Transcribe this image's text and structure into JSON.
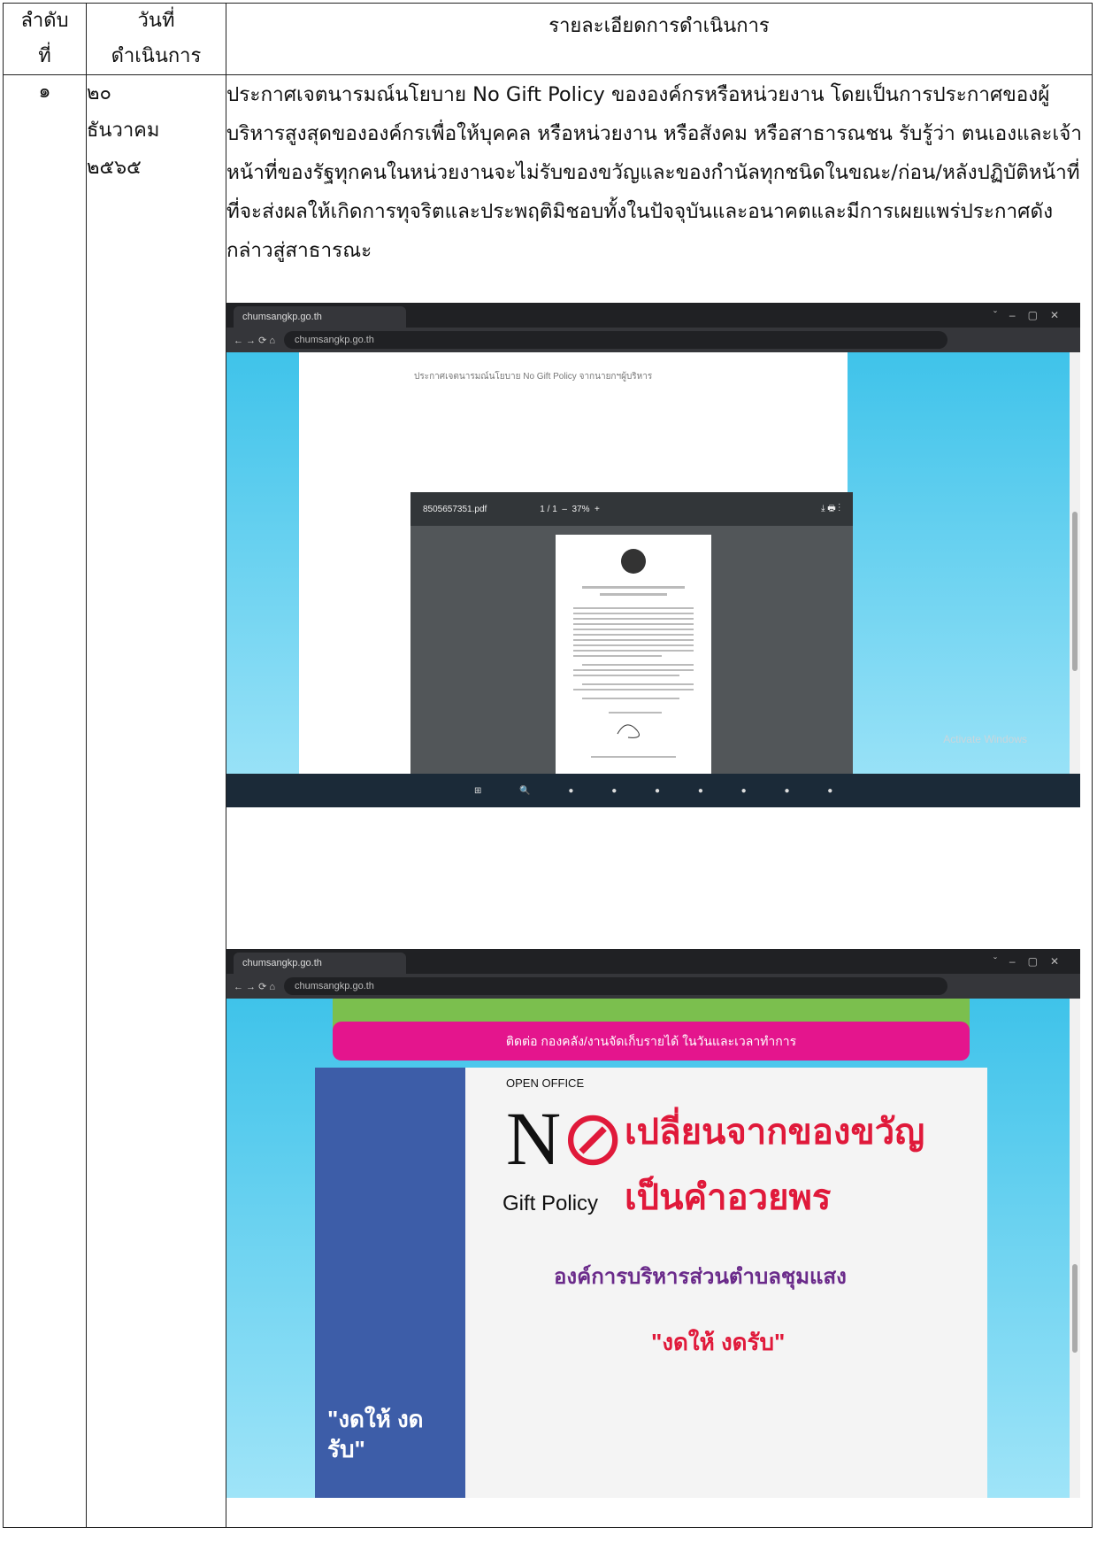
{
  "table": {
    "headers": [
      "ลำดับ\nที่",
      "วันที่\nดำเนินการ",
      "รายละเอียดการดำเนินการ"
    ],
    "row": {
      "no": "๑",
      "date_lines": [
        "๒๐",
        "ธันวาคม",
        "๒๕๖๕"
      ],
      "description": "ประกาศเจตนารมณ์นโยบาย No Gift Policy  ขององค์กรหรือหน่วยงาน โดยเป็นการประกาศของผู้บริหารสูงสุดขององค์กรเพื่อให้บุคคล หรือหน่วยงาน หรือสังคม หรือสาธารณชน รับรู้ว่า ตนเองและเจ้าหน้าที่ของรัฐทุกคนในหน่วยงานจะไม่รับของขวัญและของกำนัลทุกชนิดในขณะ/ก่อน/หลังปฏิบัติหน้าที่ ที่จะส่งผลให้เกิดการทุจริตและประพฤติมิชอบทั้งในปัจจุบันและอนาคตและมีการเผยแพร่ประกาศดังกล่าวสู่สาธารณะ"
    }
  },
  "screenshot1": {
    "url": "chumsangkp.go.th",
    "pdf_name": "8505657351.pdf",
    "pdf_page": "1 / 1",
    "zoom": "37%",
    "title_text": "ประกาศเจตนารมณ์นโยบาย No Gift Policy จากนายกฯผู้บริหาร",
    "watermark": "Activate Windows"
  },
  "screenshot2": {
    "url": "chumsangkp.go.th",
    "banner": "ติดต่อ กองคลัง/งานจัดเก็บรายได้ ในวันและเวลาทำการ",
    "open_office": "OPEN OFFICE",
    "gift_policy": "Gift Policy",
    "headline1": "เปลี่ยนจากของขวัญ",
    "headline2": "เป็นคำอวยพร",
    "org": "องค์การบริหารส่วนตำบลชุมแสง",
    "slogan": "\"งดให้ งดรับ\"",
    "left_slogan": "\"งดให้ งดรับ\""
  }
}
